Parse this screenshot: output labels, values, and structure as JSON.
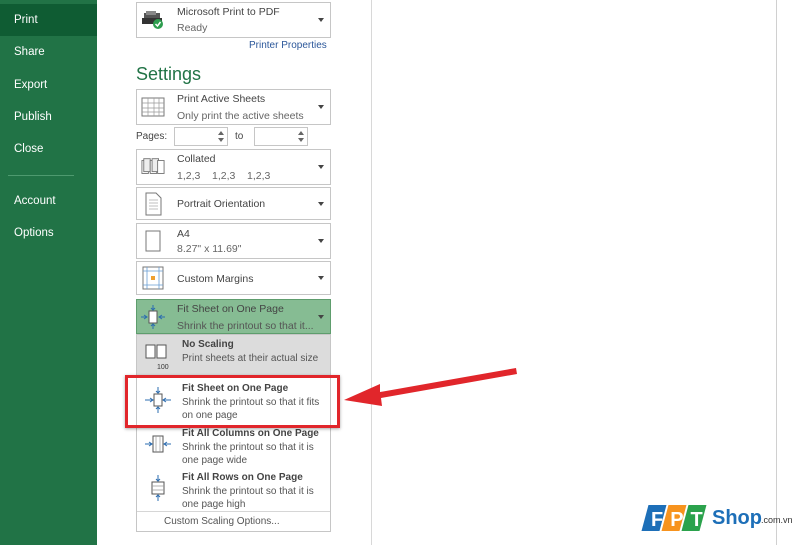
{
  "sidebar": {
    "items": [
      {
        "label": "Print",
        "active": true
      },
      {
        "label": "Share"
      },
      {
        "label": "Export"
      },
      {
        "label": "Publish"
      },
      {
        "label": "Close"
      },
      {
        "label": "Account"
      },
      {
        "label": "Options"
      }
    ]
  },
  "printer": {
    "name": "Microsoft Print to PDF",
    "status": "Ready",
    "properties_link": "Printer Properties"
  },
  "settings_title": "Settings",
  "print_what": {
    "title": "Print Active Sheets",
    "subtitle": "Only print the active sheets"
  },
  "pages": {
    "label": "Pages:",
    "to_label": "to",
    "from_value": "",
    "to_value": ""
  },
  "collation": {
    "title": "Collated",
    "subtitle": "1,2,3    1,2,3    1,2,3"
  },
  "orientation": {
    "title": "Portrait Orientation"
  },
  "paper": {
    "title": "A4",
    "subtitle": "8.27\" x 11.69\""
  },
  "margins": {
    "title": "Custom Margins"
  },
  "scaling": {
    "title": "Fit Sheet on One Page",
    "subtitle": "Shrink the printout so that it..."
  },
  "scaling_menu": {
    "items": [
      {
        "title": "No Scaling",
        "desc": "Print sheets at their actual size",
        "badge": "100"
      },
      {
        "title": "Fit Sheet on One Page",
        "desc": "Shrink the printout so that it fits on one page"
      },
      {
        "title": "Fit All Columns on One Page",
        "desc": "Shrink the printout so that it is one page wide"
      },
      {
        "title": "Fit All Rows on One Page",
        "desc": "Shrink the printout so that it is one page high"
      }
    ],
    "custom_option": "Custom Scaling Options..."
  },
  "watermark": {
    "brand": "FPT",
    "site": "Shop",
    "suffix": ".com.vn"
  },
  "colors": {
    "sidebar": "#217346",
    "accent_green": "#217346",
    "highlight": "#e1262b",
    "link": "#2b579a"
  }
}
